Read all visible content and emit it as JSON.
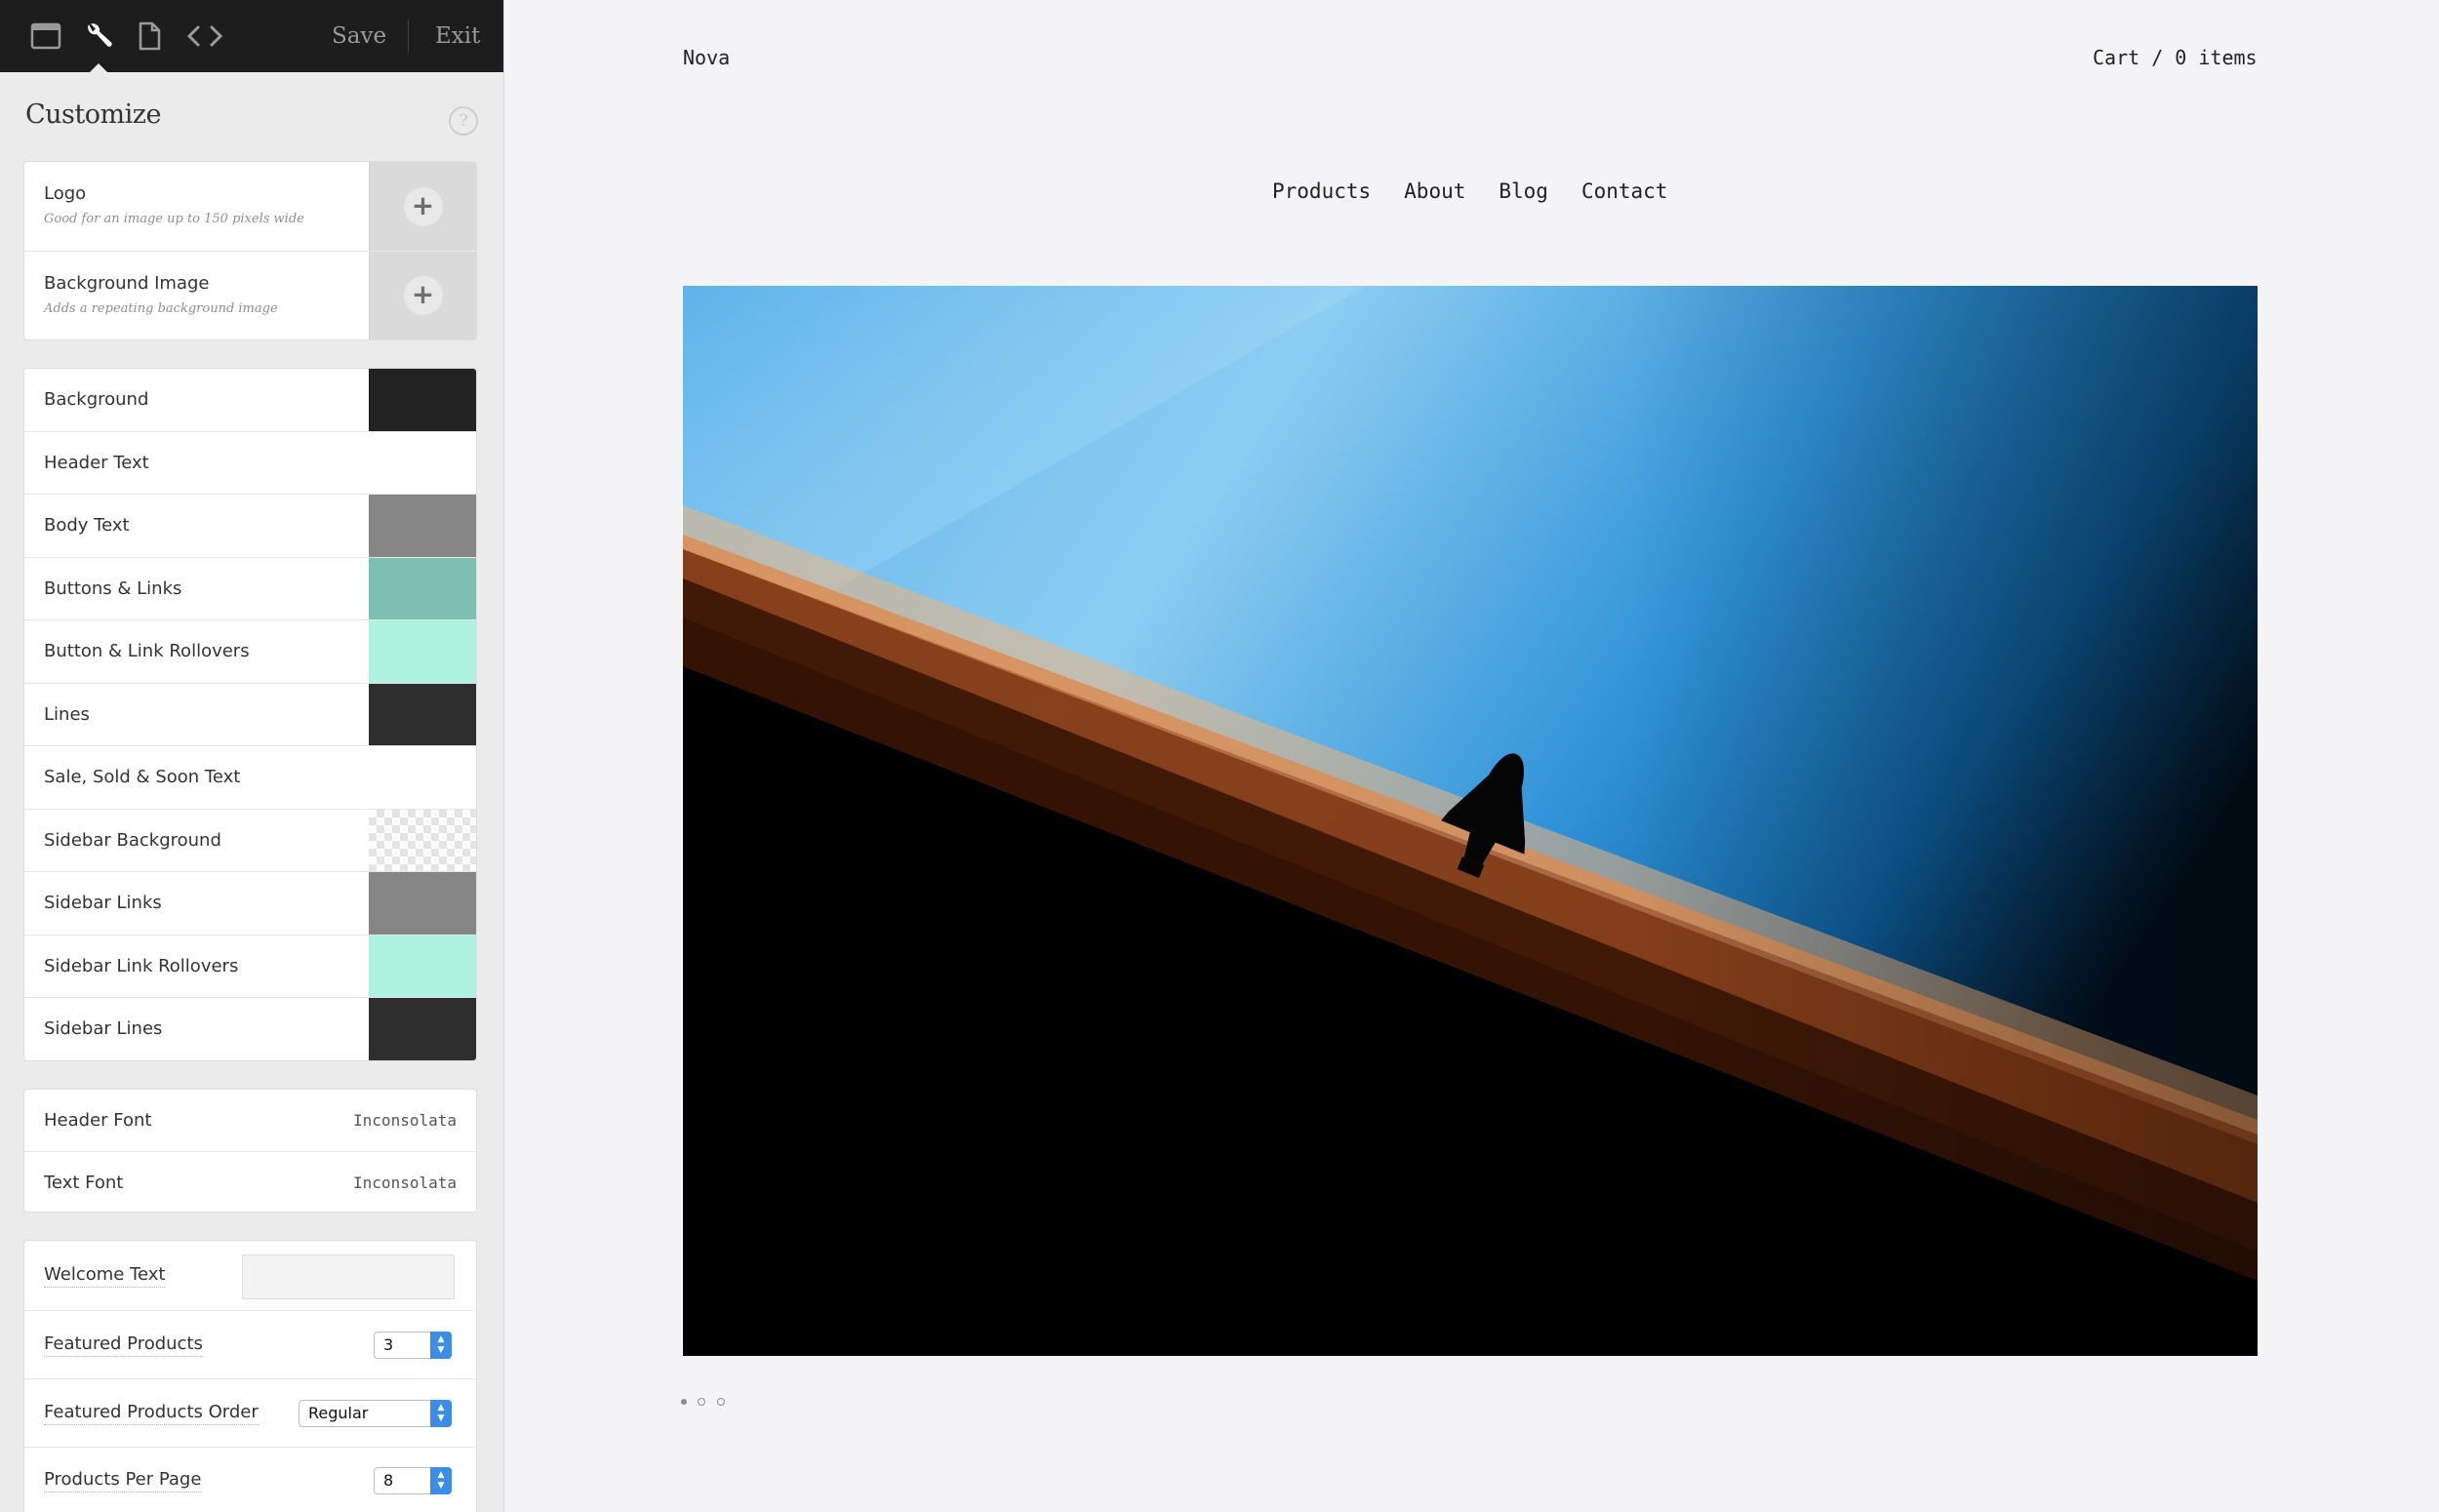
{
  "toolbar": {
    "icons": [
      "window-icon",
      "wrench-icon",
      "page-icon",
      "code-icon"
    ],
    "save_label": "Save",
    "exit_label": "Exit"
  },
  "panel": {
    "title": "Customize",
    "help_label": "?",
    "images": [
      {
        "label": "Logo",
        "hint": "Good for an image up to 150 pixels wide",
        "action": "+"
      },
      {
        "label": "Background Image",
        "hint": "Adds a repeating background image",
        "action": "+"
      }
    ],
    "colors": [
      {
        "label": "Background",
        "swatch": "#232323"
      },
      {
        "label": "Header Text",
        "swatch": "#ffffff"
      },
      {
        "label": "Body Text",
        "swatch": "#868686"
      },
      {
        "label": "Buttons & Links",
        "swatch": "#7dc0b1"
      },
      {
        "label": "Button & Link Rollovers",
        "swatch": "#adf1df"
      },
      {
        "label": "Lines",
        "swatch": "#2e2e2e"
      },
      {
        "label": "Sale, Sold & Soon Text",
        "swatch": "#ffffff"
      },
      {
        "label": "Sidebar Background",
        "swatch": "transparent"
      },
      {
        "label": "Sidebar Links",
        "swatch": "#868686"
      },
      {
        "label": "Sidebar Link Rollovers",
        "swatch": "#adf1df"
      },
      {
        "label": "Sidebar Lines",
        "swatch": "#2e2e2e"
      }
    ],
    "fonts": [
      {
        "label": "Header Font",
        "value": "Inconsolata"
      },
      {
        "label": "Text Font",
        "value": "Inconsolata"
      }
    ],
    "options": {
      "welcome_text": {
        "label": "Welcome Text",
        "value": ""
      },
      "featured_products": {
        "label": "Featured Products",
        "value": "3"
      },
      "featured_order": {
        "label": "Featured Products Order",
        "value": "Regular"
      },
      "per_page": {
        "label": "Products Per Page",
        "value": "8"
      }
    }
  },
  "store": {
    "name": "Nova",
    "cart": "Cart / 0 items",
    "nav": [
      "Products",
      "About",
      "Blog",
      "Contact"
    ],
    "slides": {
      "count": 3,
      "active_index": 0
    }
  }
}
